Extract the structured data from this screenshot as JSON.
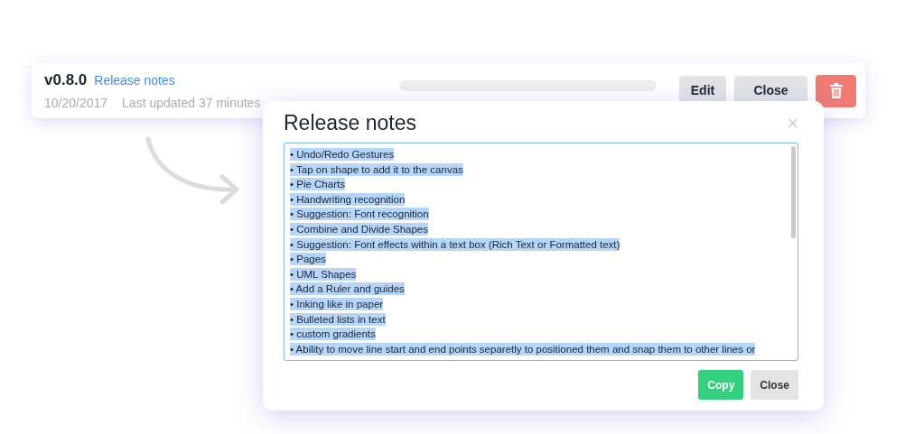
{
  "release": {
    "version": "v0.8.0",
    "link": "Release notes",
    "date": "10/20/2017",
    "updated": "Last updated 37 minutes",
    "progress": {
      "level": 0
    }
  },
  "card_buttons": [
    {
      "kind": "text",
      "label": "Edit"
    },
    {
      "kind": "text",
      "label": "Close"
    },
    {
      "kind": "delete"
    }
  ],
  "modal": {
    "title": "Release notes",
    "close": "×",
    "notes": {
      "text_selected": true,
      "lines": [
        "• Undo/Redo Gestures",
        "• Tap on shape to add it to the canvas",
        "• Pie Charts",
        "• Handwriting recognition",
        "• Suggestion: Font recognition",
        "• Combine and Divide Shapes",
        "• Suggestion: Font effects within a text box (Rich Text or Formatted text)",
        "• Pages",
        "• UML Shapes",
        "• Add a Ruler and guides",
        "• Inking like in paper",
        "• Bulleted lists in text",
        "• custom gradients",
        "• Ability to move line start and end points separetly to positioned them and snap them to other lines or"
      ]
    },
    "buttons": [
      {
        "kind": "primary",
        "label": "Copy"
      },
      {
        "kind": "secondary",
        "label": "Close"
      }
    ]
  }
}
